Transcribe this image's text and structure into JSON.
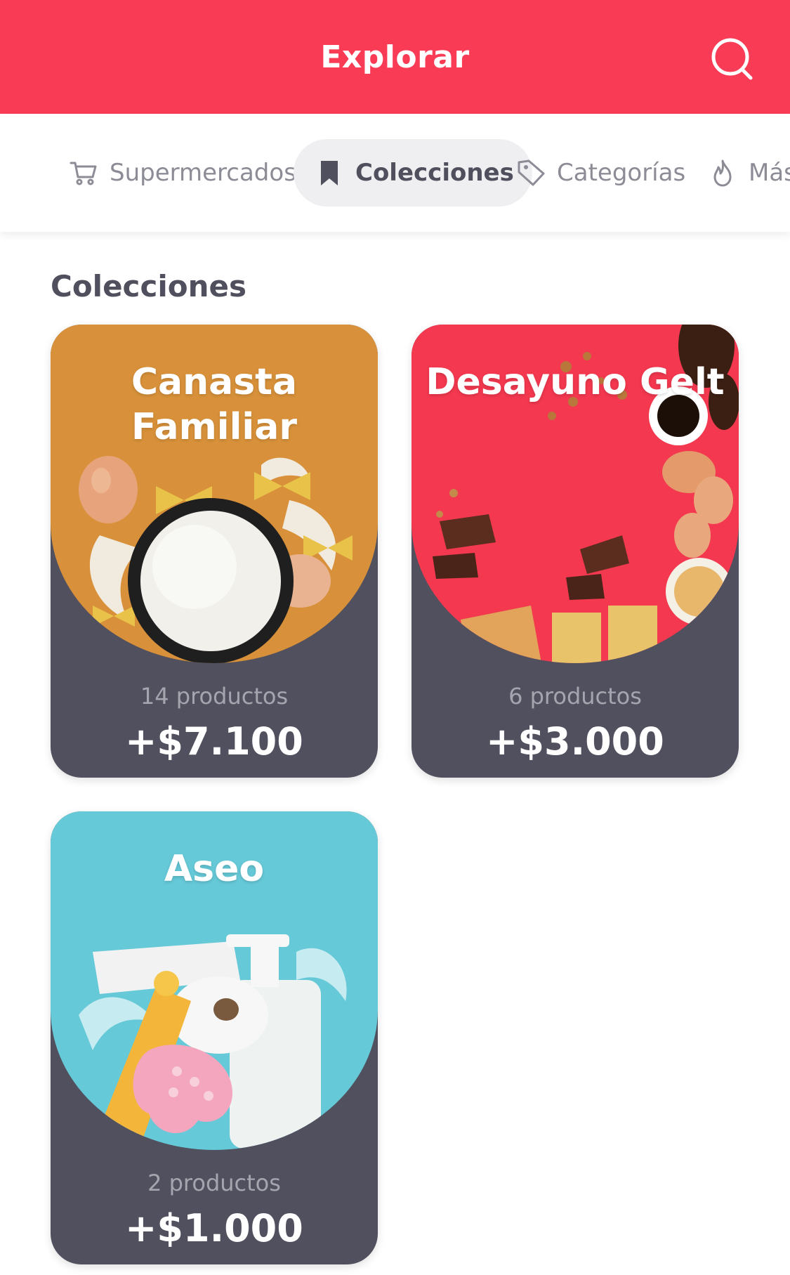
{
  "header": {
    "title": "Explorar",
    "background_color": "#f93b55",
    "search_icon": "search-icon"
  },
  "tabs": [
    {
      "label": "Supermercados",
      "icon": "cart-icon",
      "active": false
    },
    {
      "label": "Colecciones",
      "icon": "bookmark-icon",
      "active": true
    },
    {
      "label": "Categorías",
      "icon": "tag-icon",
      "active": false
    },
    {
      "label": "Más",
      "icon": "flame-icon",
      "active": false
    }
  ],
  "section": {
    "title": "Colecciones"
  },
  "collections": [
    {
      "title_line1": "Canasta",
      "title_line2": "Familiar",
      "count": "14 productos",
      "price": "+$7.100",
      "art_color": "#d8913a"
    },
    {
      "title_line1": "Desayuno Gelt",
      "count": "6 productos",
      "price": "+$3.000",
      "art_color": "#f3384f"
    },
    {
      "title_line1": "Aseo",
      "count": "2 productos",
      "price": "+$1.000",
      "art_color": "#66c9d8"
    }
  ],
  "colors": {
    "card_bottom": "#51505e",
    "text_dark": "#4f4f5d",
    "tab_inactive": "#8c8c96",
    "tab_active_bg": "#efeff2"
  }
}
